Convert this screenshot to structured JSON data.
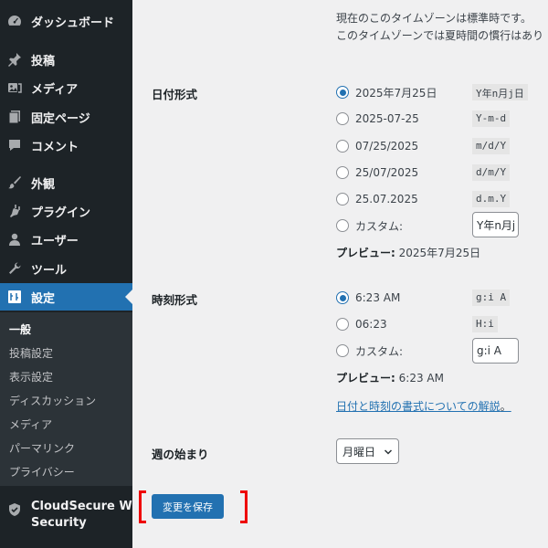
{
  "sidebar": {
    "dashboard": {
      "label": "ダッシュボード",
      "icon": "dashboard-icon"
    },
    "posts": {
      "label": "投稿",
      "icon": "pin-icon"
    },
    "media": {
      "label": "メディア",
      "icon": "media-icon"
    },
    "pages": {
      "label": "固定ページ",
      "icon": "page-icon"
    },
    "comments": {
      "label": "コメント",
      "icon": "comment-icon"
    },
    "appearance": {
      "label": "外観",
      "icon": "brush-icon"
    },
    "plugins": {
      "label": "プラグイン",
      "icon": "plugin-icon"
    },
    "users": {
      "label": "ユーザー",
      "icon": "user-icon"
    },
    "tools": {
      "label": "ツール",
      "icon": "wrench-icon"
    },
    "settings": {
      "label": "設定",
      "icon": "settings-icon"
    },
    "submenu": [
      "一般",
      "投稿設定",
      "表示設定",
      "ディスカッション",
      "メディア",
      "パーマリンク",
      "プライバシー"
    ],
    "cloudsecure": {
      "label_line1": "CloudSecure WP",
      "label_line2": "Security",
      "icon": "shield-check-icon"
    }
  },
  "timezone": {
    "note_line1": "現在のこのタイムゾーンは標準時です。",
    "note_line2": "このタイムゾーンでは夏時間の慣行はあり"
  },
  "date_format": {
    "label": "日付形式",
    "options": [
      {
        "text": "2025年7月25日",
        "format": "Y年n月j日",
        "checked": true
      },
      {
        "text": "2025-07-25",
        "format": "Y-m-d",
        "checked": false
      },
      {
        "text": "07/25/2025",
        "format": "m/d/Y",
        "checked": false
      },
      {
        "text": "25/07/2025",
        "format": "d/m/Y",
        "checked": false
      },
      {
        "text": "25.07.2025",
        "format": "d.m.Y",
        "checked": false
      }
    ],
    "custom_label": "カスタム:",
    "custom_value": "Y年n月j日",
    "preview_label": "プレビュー:",
    "preview_value": "2025年7月25日"
  },
  "time_format": {
    "label": "時刻形式",
    "options": [
      {
        "text": "6:23 AM",
        "format": "g:i A",
        "checked": true
      },
      {
        "text": "06:23",
        "format": "H:i",
        "checked": false
      }
    ],
    "custom_label": "カスタム:",
    "custom_value": "g:i A",
    "preview_label": "プレビュー:",
    "preview_value": "6:23 AM"
  },
  "doc_link": {
    "text": "日付と時刻の書式についての解説",
    "suffix": "。"
  },
  "week_start": {
    "label": "週の始まり",
    "value": "月曜日"
  },
  "save_button": {
    "label": "変更を保存"
  },
  "colors": {
    "sidebar_bg": "#1d2327",
    "accent": "#2271b1",
    "highlight": "#ee0000"
  }
}
